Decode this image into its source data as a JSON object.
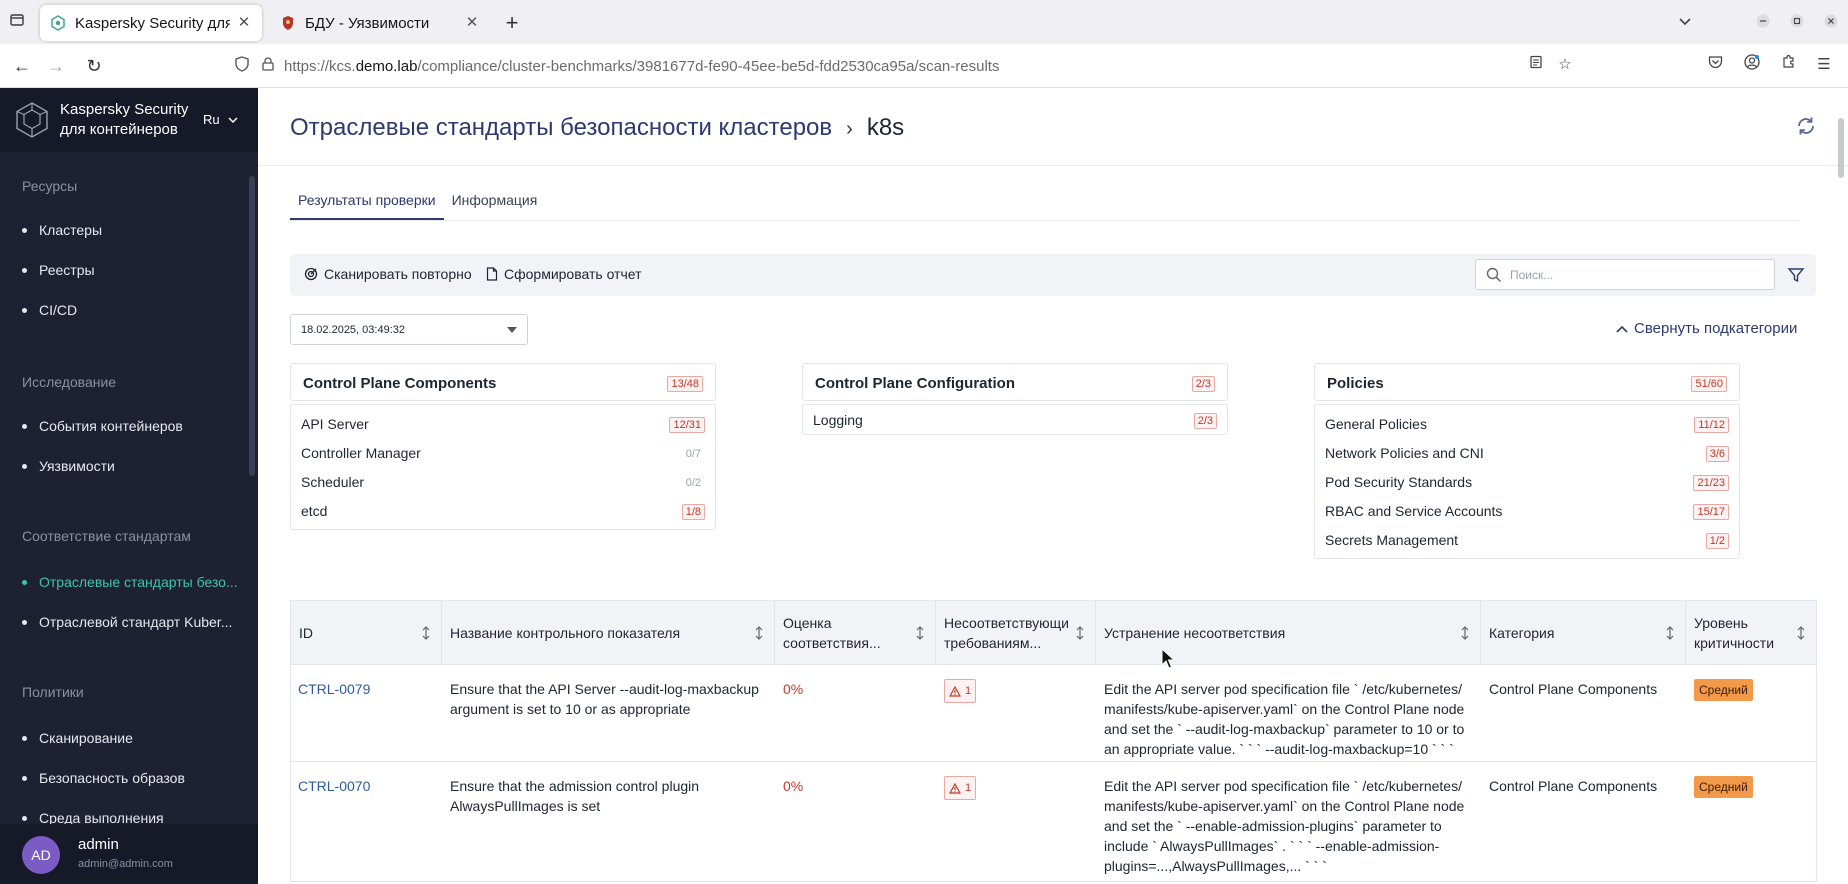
{
  "browser": {
    "tabs": [
      {
        "title": "Kaspersky Security для контейнеров",
        "active": true
      },
      {
        "title": "БДУ - Уязвимости",
        "active": false
      }
    ],
    "url": {
      "prefix": "https://kcs.",
      "host": "demo.lab",
      "path": "/compliance/cluster-benchmarks/3981677d-fe90-45ee-be5d-fdd2530ca95a/scan-results"
    }
  },
  "sidebar": {
    "brand_line1": "Kaspersky Security",
    "brand_line2": "для контейнеров",
    "lang": "Ru",
    "sections": [
      {
        "title": "Ресурсы",
        "items": [
          "Кластеры",
          "Реестры",
          "CI/CD"
        ]
      },
      {
        "title": "Исследование",
        "items": [
          "События контейнеров",
          "Уязвимости"
        ]
      },
      {
        "title": "Соответствие стандартам",
        "items": [
          "Отраслевые стандарты безо...",
          "Отраслевой стандарт Kuber..."
        ]
      },
      {
        "title": "Политики",
        "items": [
          "Сканирование",
          "Безопасность образов",
          "Среда выполнения"
        ]
      }
    ],
    "user": {
      "initials": "AD",
      "name": "admin",
      "email": "admin@admin.com"
    }
  },
  "page": {
    "title": "Отраслевые стандарты безопасности кластеров",
    "breadcrumb_sep": "›",
    "current": "k8s"
  },
  "tabs": {
    "results": "Результаты проверки",
    "info": "Информация"
  },
  "toolbar": {
    "rescan": "Сканировать повторно",
    "report": "Сформировать отчет",
    "search_placeholder": "Поиск..."
  },
  "date_select": {
    "value": "18.02.2025, 03:49:32"
  },
  "collapse_label": "Свернуть подкатегории",
  "categories": [
    {
      "title": "Control Plane Components",
      "count": "13/48",
      "subs": [
        {
          "name": "API Server",
          "count": "12/31",
          "fail": true
        },
        {
          "name": "Controller Manager",
          "count": "0/7",
          "fail": false
        },
        {
          "name": "Scheduler",
          "count": "0/2",
          "fail": false
        },
        {
          "name": "etcd",
          "count": "1/8",
          "fail": true
        }
      ]
    },
    {
      "title": "Control Plane Configuration",
      "count": "2/3",
      "subs": [
        {
          "name": "Logging",
          "count": "2/3",
          "fail": true
        }
      ]
    },
    {
      "title": "Policies",
      "count": "51/60",
      "subs": [
        {
          "name": "General Policies",
          "count": "11/12",
          "fail": true
        },
        {
          "name": "Network Policies and CNI",
          "count": "3/6",
          "fail": true
        },
        {
          "name": "Pod Security Standards",
          "count": "21/23",
          "fail": true
        },
        {
          "name": "RBAC and Service Accounts",
          "count": "15/17",
          "fail": true
        },
        {
          "name": "Secrets Management",
          "count": "1/2",
          "fail": true
        }
      ]
    }
  ],
  "table": {
    "columns": [
      "ID",
      "Название контрольного показателя",
      "Оценка соответствия...",
      "Несоответствующи требованиям...",
      "Устранение несоответствия",
      "Категория",
      "Уровень критичности"
    ],
    "rows": [
      {
        "id": "CTRL-0079",
        "name": "Ensure that the API Server --audit-log-maxbackup argument is set to 10 or as appropriate",
        "score": "0%",
        "failed": "1",
        "remediation": "Edit the API server pod specification file ` /etc/kubernetes/ manifests/kube-apiserver.yaml`  on the Control Plane node and set the ` --audit-log-maxbackup`  parameter to 10 or to an appropriate value. ` ` `  --audit-log-maxbackup=10 ` ` `",
        "category": "Control Plane Components",
        "severity": "Средний"
      },
      {
        "id": "CTRL-0070",
        "name": "Ensure that the admission control plugin AlwaysPullImages is set",
        "score": "0%",
        "failed": "1",
        "remediation": "Edit the API server pod specification file ` /etc/kubernetes/ manifests/kube-apiserver.yaml`  on the Control Plane node and set the ` --enable-admission-plugins`  parameter to include ` AlwaysPullImages` . ` ` `  --enable-admission-plugins=...,AlwaysPullImages,... ` ` `",
        "category": "Control Plane Components",
        "severity": "Средний"
      }
    ]
  },
  "colors": {
    "sidebar_bg": "#1d2132",
    "accent": "#3fc5a6",
    "title": "#2c3a6e",
    "danger": "#c0392b",
    "warning": "#f2994a"
  }
}
